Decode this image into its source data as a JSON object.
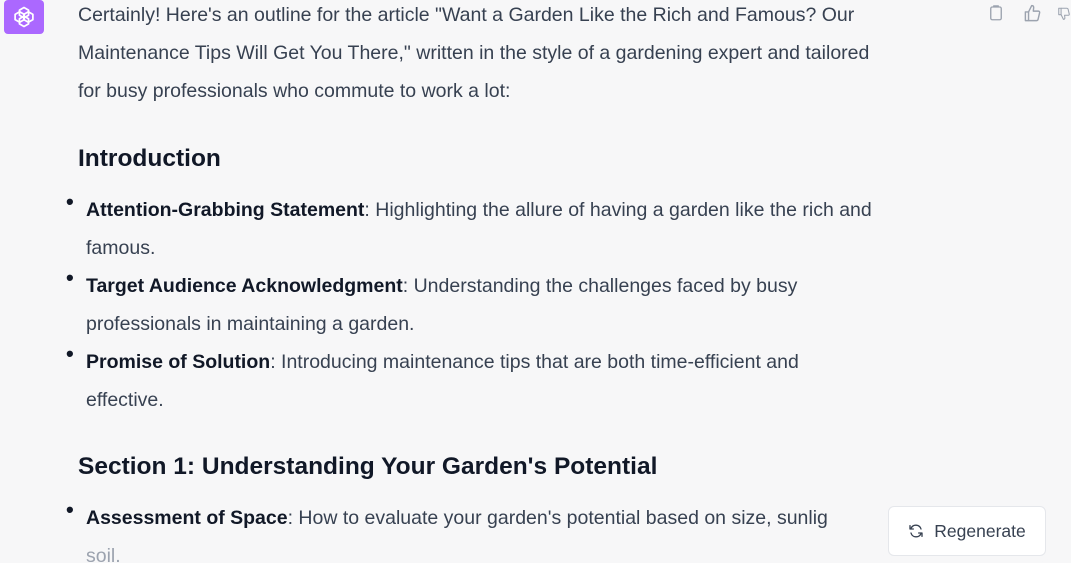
{
  "assistant": {
    "avatar_icon": "openai-logo-icon",
    "avatar_color": "#ab68ff"
  },
  "message": {
    "intro_line1": "Certainly! Here's an outline for the article \"Want a Garden Like the Rich and Famous? Our",
    "intro_line2": "Maintenance Tips Will Get You There,\" written in the style of a gardening expert and tailored",
    "intro_line3": "for busy professionals who commute to work a lot:",
    "sections": [
      {
        "heading": "Introduction",
        "items": [
          {
            "title": "Attention-Grabbing Statement",
            "text_line1": ": Highlighting the allure of having a garden like the rich and",
            "text_line2": "famous."
          },
          {
            "title": "Target Audience Acknowledgment",
            "text_line1": ": Understanding the challenges faced by busy",
            "text_line2": "professionals in maintaining a garden."
          },
          {
            "title": "Promise of Solution",
            "text_line1": ": Introducing maintenance tips that are both time-efficient and",
            "text_line2": "effective."
          }
        ]
      },
      {
        "heading": "Section 1: Understanding Your Garden's Potential",
        "items": [
          {
            "title": "Assessment of Space",
            "text_line1": ": How to evaluate your garden's potential based on size, sunlig",
            "text_line2": "soil."
          }
        ]
      }
    ]
  },
  "actions": {
    "copy_icon": "clipboard-icon",
    "thumbs_up_icon": "thumbs-up-icon",
    "thumbs_down_icon": "thumbs-down-icon"
  },
  "regenerate": {
    "icon": "refresh-icon",
    "label": "Regenerate"
  }
}
